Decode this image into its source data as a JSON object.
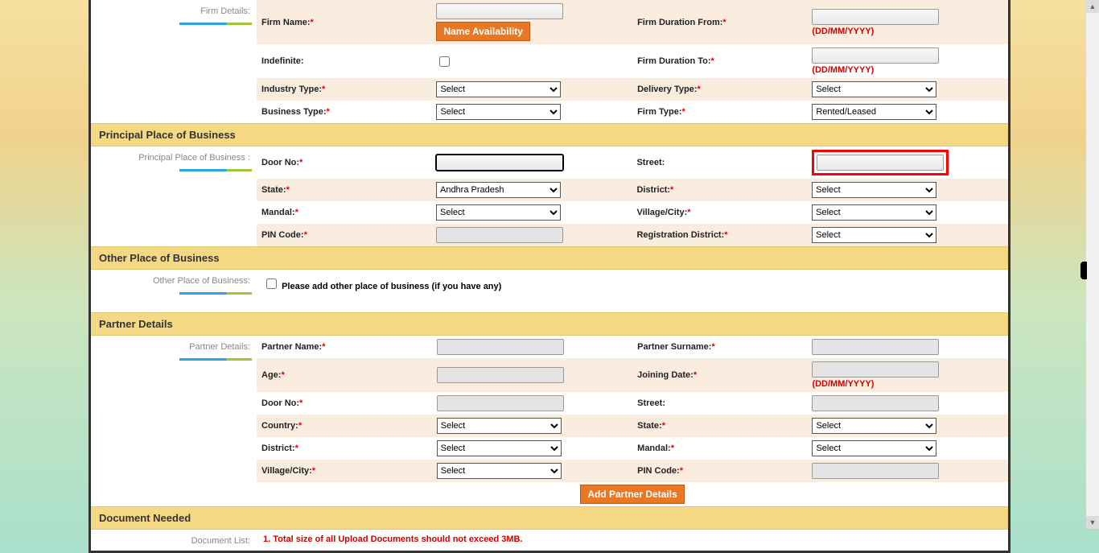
{
  "common": {
    "select_placeholder": "Select",
    "date_hint": "(DD/MM/YYYY)"
  },
  "firm": {
    "side_label": "Firm Details:",
    "name_label": "Firm Name:",
    "name_availability_btn": "Name Availability",
    "duration_from_label": "Firm Duration From:",
    "indefinite_label": "Indefinite:",
    "duration_to_label": "Firm Duration To:",
    "industry_label": "Industry Type:",
    "delivery_label": "Delivery Type:",
    "business_label": "Business Type:",
    "firm_type_label": "Firm Type:",
    "firm_type_value": "Rented/Leased"
  },
  "principal": {
    "header": "Principal Place of Business",
    "side_label": "Principal Place of Business :",
    "door_label": "Door No:",
    "street_label": "Street:",
    "state_label": "State:",
    "state_value": "Andhra Pradesh",
    "district_label": "District:",
    "mandal_label": "Mandal:",
    "village_label": "Village/City:",
    "pin_label": "PIN Code:",
    "reg_dist_label": "Registration District:"
  },
  "other": {
    "header": "Other Place of Business",
    "side_label": "Other Place of Business:",
    "checkbox_label": "Please add other place of business (if you have any)"
  },
  "partner": {
    "header": "Partner Details",
    "side_label": "Partner Details:",
    "name_label": "Partner Name:",
    "surname_label": "Partner Surname:",
    "age_label": "Age:",
    "joining_label": "Joining Date:",
    "door_label": "Door No:",
    "street_label": "Street:",
    "country_label": "Country:",
    "state_label": "State:",
    "district_label": "District:",
    "mandal_label": "Mandal:",
    "village_label": "Village/City:",
    "pin_label": "PIN Code:",
    "add_btn": "Add Partner Details"
  },
  "document": {
    "header": "Document Needed",
    "side_label": "Document List:",
    "note1": "1. Total size of all Upload Documents should not exceed 3MB."
  }
}
